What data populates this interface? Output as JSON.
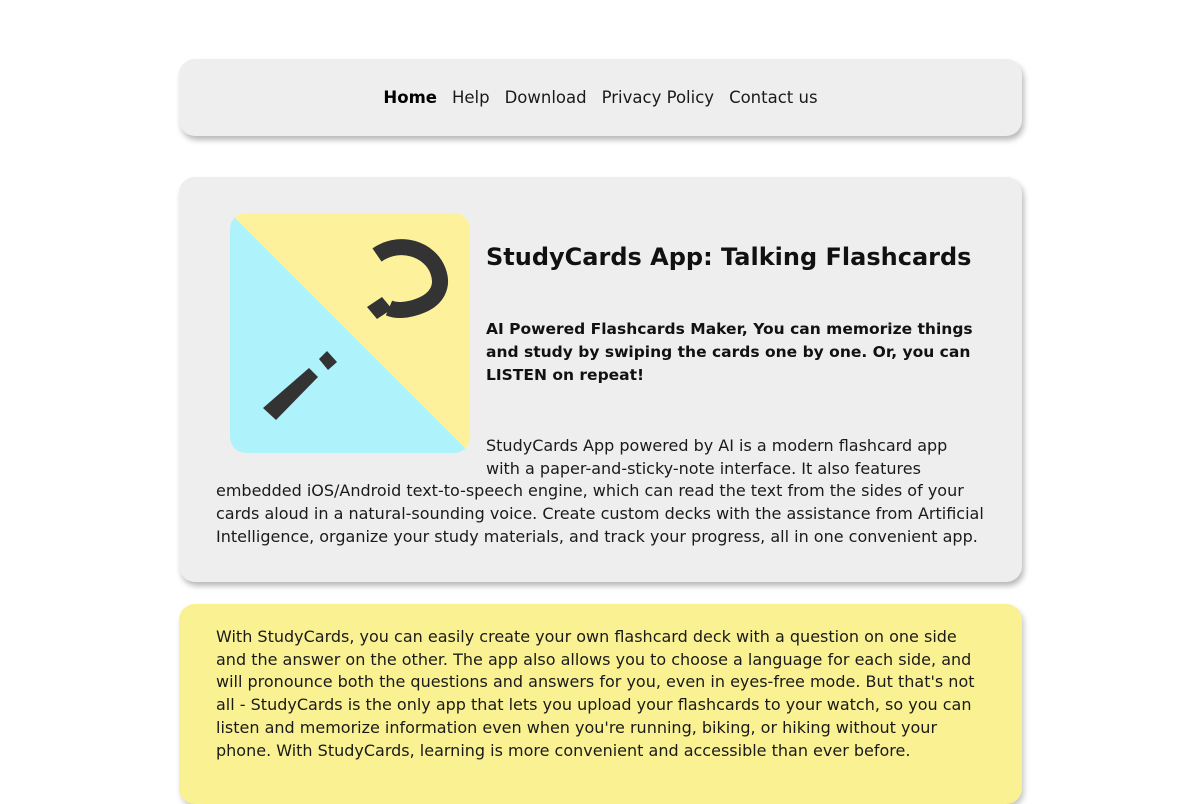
{
  "nav": {
    "items": [
      {
        "label": "Home",
        "active": true
      },
      {
        "label": "Help"
      },
      {
        "label": "Download"
      },
      {
        "label": "Privacy Policy"
      },
      {
        "label": "Contact us"
      }
    ]
  },
  "hero": {
    "logo_icon": "question-mark-exclamation-logo-icon",
    "logo_colors": {
      "yellow": "#fdf29b",
      "cyan": "#aef2fb",
      "glyph": "#333333"
    },
    "title": "StudyCards App: Talking Flashcards",
    "subtitle": "AI Powered Flashcards Maker, You can memorize things and study by swiping the cards one by one. Or, you can LISTEN on repeat!",
    "body": "StudyCards App powered by AI is a modern flashcard app with a paper-and-sticky-note interface. It also features embedded iOS/Android text-to-speech engine, which can read the text from the sides of your cards aloud in a natural-sounding voice. Create custom decks with the assistance from Artificial Intelligence, organize your study materials, and track your progress, all in one convenient app."
  },
  "feature": {
    "text": "With StudyCards, you can easily create your own flashcard deck with a question on one side and the answer on the other. The app also allows you to choose a language for each side, and will pronounce both the questions and answers for you, even in eyes-free mode. But that's not all - StudyCards is the only app that lets you upload your flashcards to your watch, so you can listen and memorize information even when you're running, biking, or hiking without your phone. With StudyCards, learning is more convenient and accessible than ever before."
  }
}
